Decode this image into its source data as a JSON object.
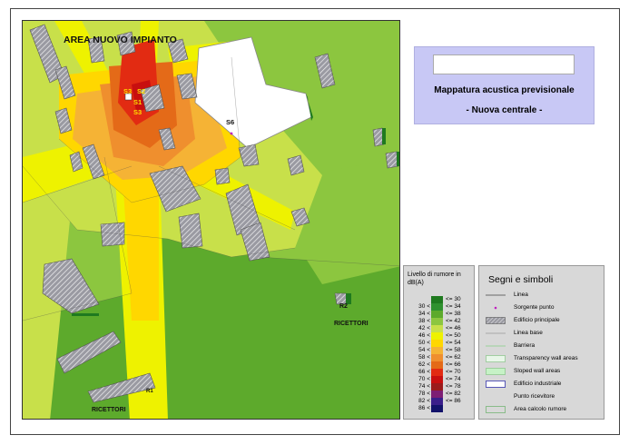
{
  "map": {
    "area_label": "AREA NUOVO IMPIANTO",
    "sources": [
      "S3",
      "S2",
      "S1",
      "S3",
      "S6"
    ],
    "receivers": [
      "R2",
      "R1"
    ],
    "receivers_label_1": "RICETTORI",
    "receivers_label_2": "RICETTORI"
  },
  "title_box": {
    "line1": "Mappatura acustica previsionale",
    "line2": "- Nuova centrale -"
  },
  "noise_scale": {
    "title": "Livello di rumore in dB(A)",
    "rows": [
      {
        "lo": "",
        "hi": "<= 30",
        "color": "#1f7a1f"
      },
      {
        "lo": "30 <",
        "hi": "<= 34",
        "color": "#2f912f"
      },
      {
        "lo": "34 <",
        "hi": "<= 38",
        "color": "#5daa2c"
      },
      {
        "lo": "38 <",
        "hi": "<= 42",
        "color": "#8cc63f"
      },
      {
        "lo": "42 <",
        "hi": "<= 46",
        "color": "#c8e04a"
      },
      {
        "lo": "46 <",
        "hi": "<= 50",
        "color": "#eef200"
      },
      {
        "lo": "50 <",
        "hi": "<= 54",
        "color": "#ffd700"
      },
      {
        "lo": "54 <",
        "hi": "<= 58",
        "color": "#f5b335"
      },
      {
        "lo": "58 <",
        "hi": "<= 62",
        "color": "#ef8f2e"
      },
      {
        "lo": "62 <",
        "hi": "<= 66",
        "color": "#e46a18"
      },
      {
        "lo": "66 <",
        "hi": "<= 70",
        "color": "#e22b12"
      },
      {
        "lo": "70 <",
        "hi": "<= 74",
        "color": "#c80f0f"
      },
      {
        "lo": "74 <",
        "hi": "<= 78",
        "color": "#9b1b1b"
      },
      {
        "lo": "78 <",
        "hi": "<= 82",
        "color": "#7d1e74"
      },
      {
        "lo": "82 <",
        "hi": "<= 86",
        "color": "#3a1e8a"
      },
      {
        "lo": "86 <",
        "hi": "",
        "color": "#12126a"
      }
    ]
  },
  "symbols": {
    "title": "Segni e simboli",
    "items": [
      {
        "label": "Linea",
        "icon": "line-icon"
      },
      {
        "label": "Sorgente punto",
        "icon": "point-source-icon"
      },
      {
        "label": "Edificio principale",
        "icon": "hatched-building-icon"
      },
      {
        "label": "Linea base",
        "icon": "base-line-icon"
      },
      {
        "label": "Barriera",
        "icon": "barrier-icon"
      },
      {
        "label": "Transparency wall areas",
        "icon": "transparency-wall-icon"
      },
      {
        "label": "Sloped wall areas",
        "icon": "sloped-wall-icon"
      },
      {
        "label": "Edificio industriale",
        "icon": "industrial-building-icon"
      },
      {
        "label": "Punto ricevitore",
        "icon": "receiver-point-icon"
      },
      {
        "label": "Area calcolo rumore",
        "icon": "calculation-area-icon"
      }
    ]
  }
}
